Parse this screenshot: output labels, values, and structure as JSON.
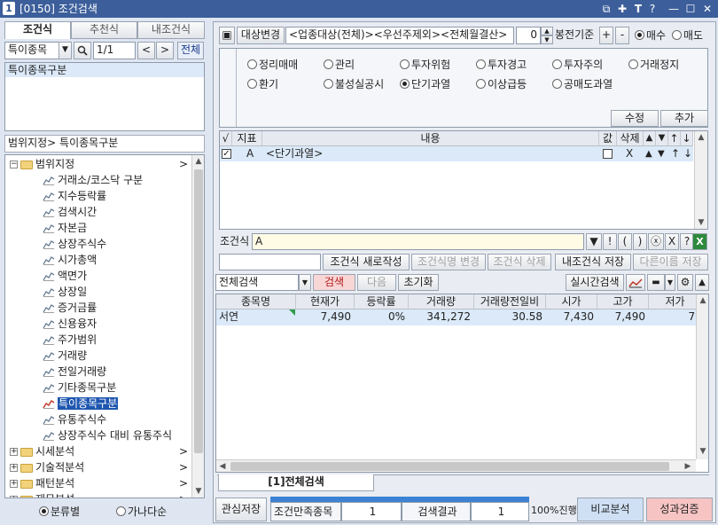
{
  "window": {
    "number": "1",
    "title": "[0150] 조건검색"
  },
  "left": {
    "tabs": [
      "조건식",
      "추천식",
      "내조건식"
    ],
    "combo": "특이종목",
    "page": "1/1",
    "all_label": "전체",
    "list_item": "특이종목구분",
    "breadcrumb": "범위지정> 특이종목구분",
    "tree": {
      "root": "범위지정",
      "children": [
        "거래소/코스닥 구분",
        "지수등락률",
        "검색시간",
        "자본금",
        "상장주식수",
        "시가총액",
        "액면가",
        "상장일",
        "증거금률",
        "신용융자",
        "주가범위",
        "거래량",
        "전일거래량",
        "기타종목구분",
        "특이종목구분",
        "유통주식수",
        "상장주식수 대비 유통주식"
      ],
      "groups": [
        "시세분석",
        "기술적분석",
        "패턴분석",
        "재무분석"
      ]
    },
    "sort_options": [
      "분류별",
      "가나다순"
    ]
  },
  "top": {
    "target_btn": "대상변경",
    "target_text": "<업종대상(전체)><우선주제외><전체월결산>",
    "count": "0",
    "bong": "봉전기준",
    "plus": "+",
    "minus": "-",
    "buy": "매수",
    "sell": "매도"
  },
  "options": {
    "row1": [
      "정리매매",
      "관리",
      "투자위험",
      "투자경고",
      "투자주의",
      "거래정지"
    ],
    "row2": [
      "환기",
      "불성실공시",
      "단기과열",
      "이상급등",
      "공매도과열"
    ],
    "selected": "단기과열",
    "edit": "수정",
    "add": "추가"
  },
  "cond_table": {
    "headers": [
      "√",
      "지표",
      "내용",
      "값",
      "삭제",
      "▲",
      "▼",
      "↑",
      "↓"
    ],
    "row": {
      "indicator": "A",
      "content": "<단기과열>",
      "delete": "X"
    }
  },
  "formula": {
    "label": "조건식",
    "value": "A",
    "btns": [
      "▼",
      "!",
      "(",
      ")",
      "ⓧ",
      "X",
      "?"
    ]
  },
  "actions": {
    "new": "조건식 새로작성",
    "rename": "조건식명 변경",
    "delete": "조건식 삭제",
    "save": "내조건식 저장",
    "save_as": "다른이름 저장"
  },
  "search": {
    "combo": "전체검색",
    "search": "검색",
    "next": "다음",
    "reset": "초기화",
    "realtime": "실시간검색"
  },
  "results": {
    "headers": [
      "종목명",
      "현재가",
      "등락률",
      "거래량",
      "거래량전일비",
      "시가",
      "고가",
      "저가"
    ],
    "rows": [
      [
        "서연",
        "7,490",
        "0%",
        "341,272",
        "30.58",
        "7,430",
        "7,490",
        "7,"
      ]
    ]
  },
  "bottom": {
    "tab": "[1]전체검색",
    "watch_save": "관심저장",
    "cond_label": "조건만족종목",
    "cond_count": "1",
    "result_label": "검색결과",
    "result_count": "1",
    "progress": "100%진행",
    "compare": "비교분석",
    "perf": "성과검증"
  },
  "colors": {
    "title_bar": "#3c5f9b",
    "selection": "#dbe9f8",
    "perf_btn": "#f7c4c4",
    "compare_btn": "#cfe0f5"
  }
}
